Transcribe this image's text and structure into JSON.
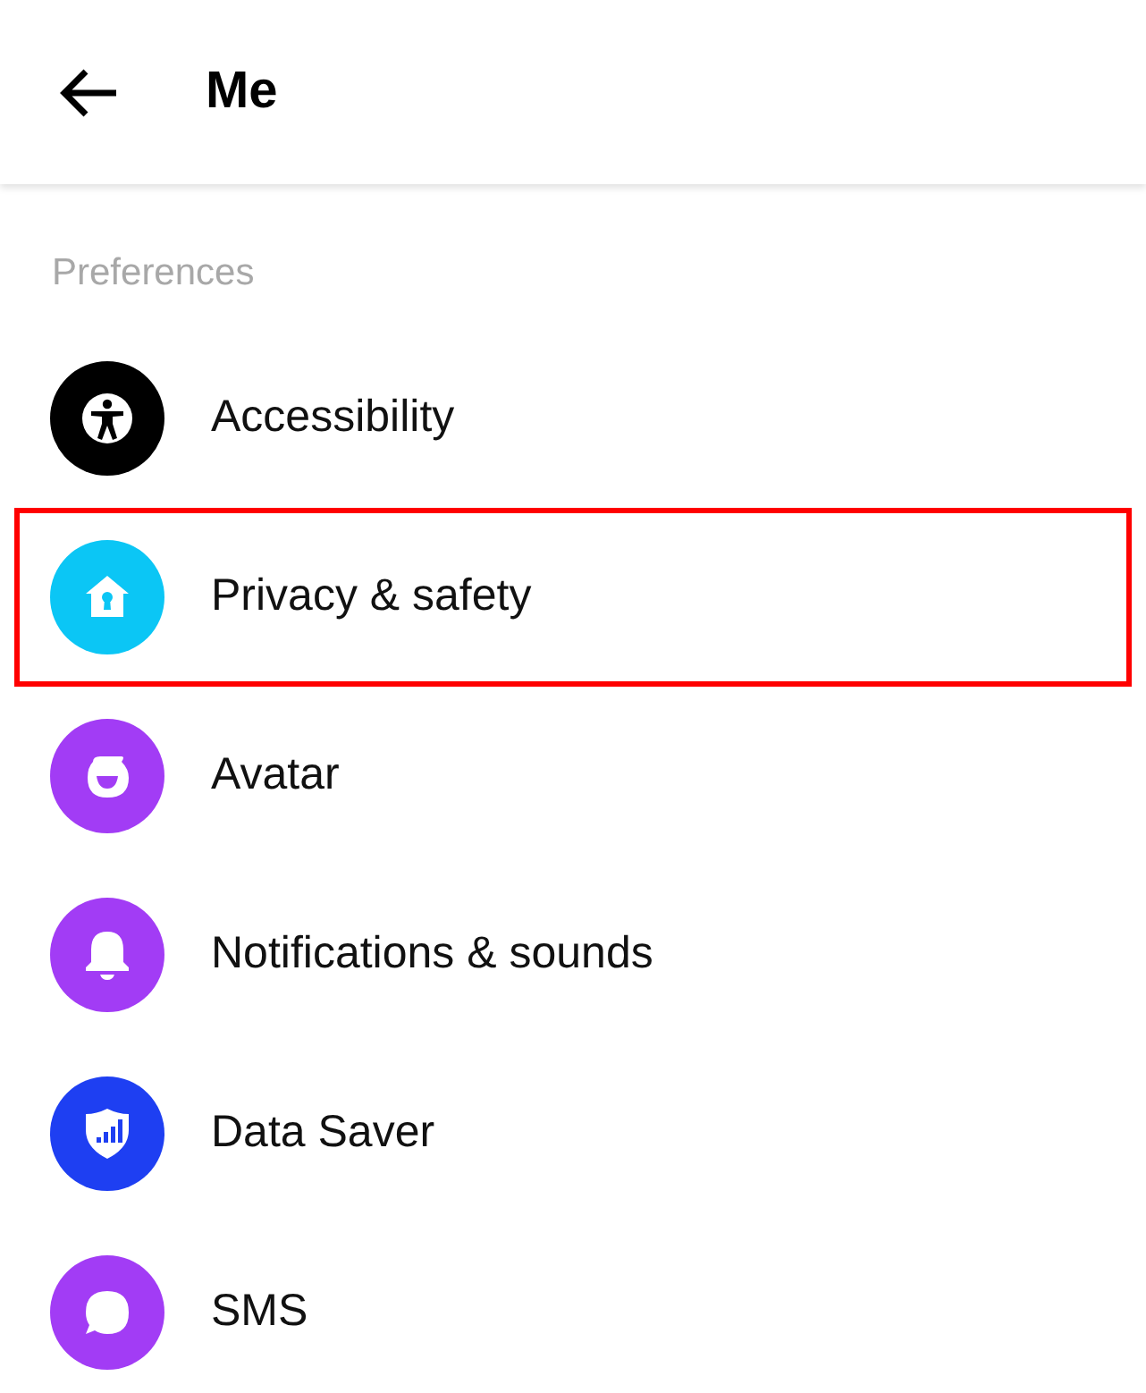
{
  "header": {
    "title": "Me"
  },
  "section": {
    "label": "Preferences"
  },
  "items": [
    {
      "label": "Accessibility",
      "kind": "accessibility",
      "color": "#000000",
      "highlighted": false
    },
    {
      "label": "Privacy & safety",
      "kind": "privacy",
      "color": "#0bc6f5",
      "highlighted": true
    },
    {
      "label": "Avatar",
      "kind": "avatar",
      "color": "#a23cf5",
      "highlighted": false
    },
    {
      "label": "Notifications & sounds",
      "kind": "bell",
      "color": "#a23cf5",
      "highlighted": false
    },
    {
      "label": "Data Saver",
      "kind": "shield",
      "color": "#1e3ff2",
      "highlighted": false
    },
    {
      "label": "SMS",
      "kind": "sms",
      "color": "#a23cf5",
      "highlighted": false
    }
  ]
}
